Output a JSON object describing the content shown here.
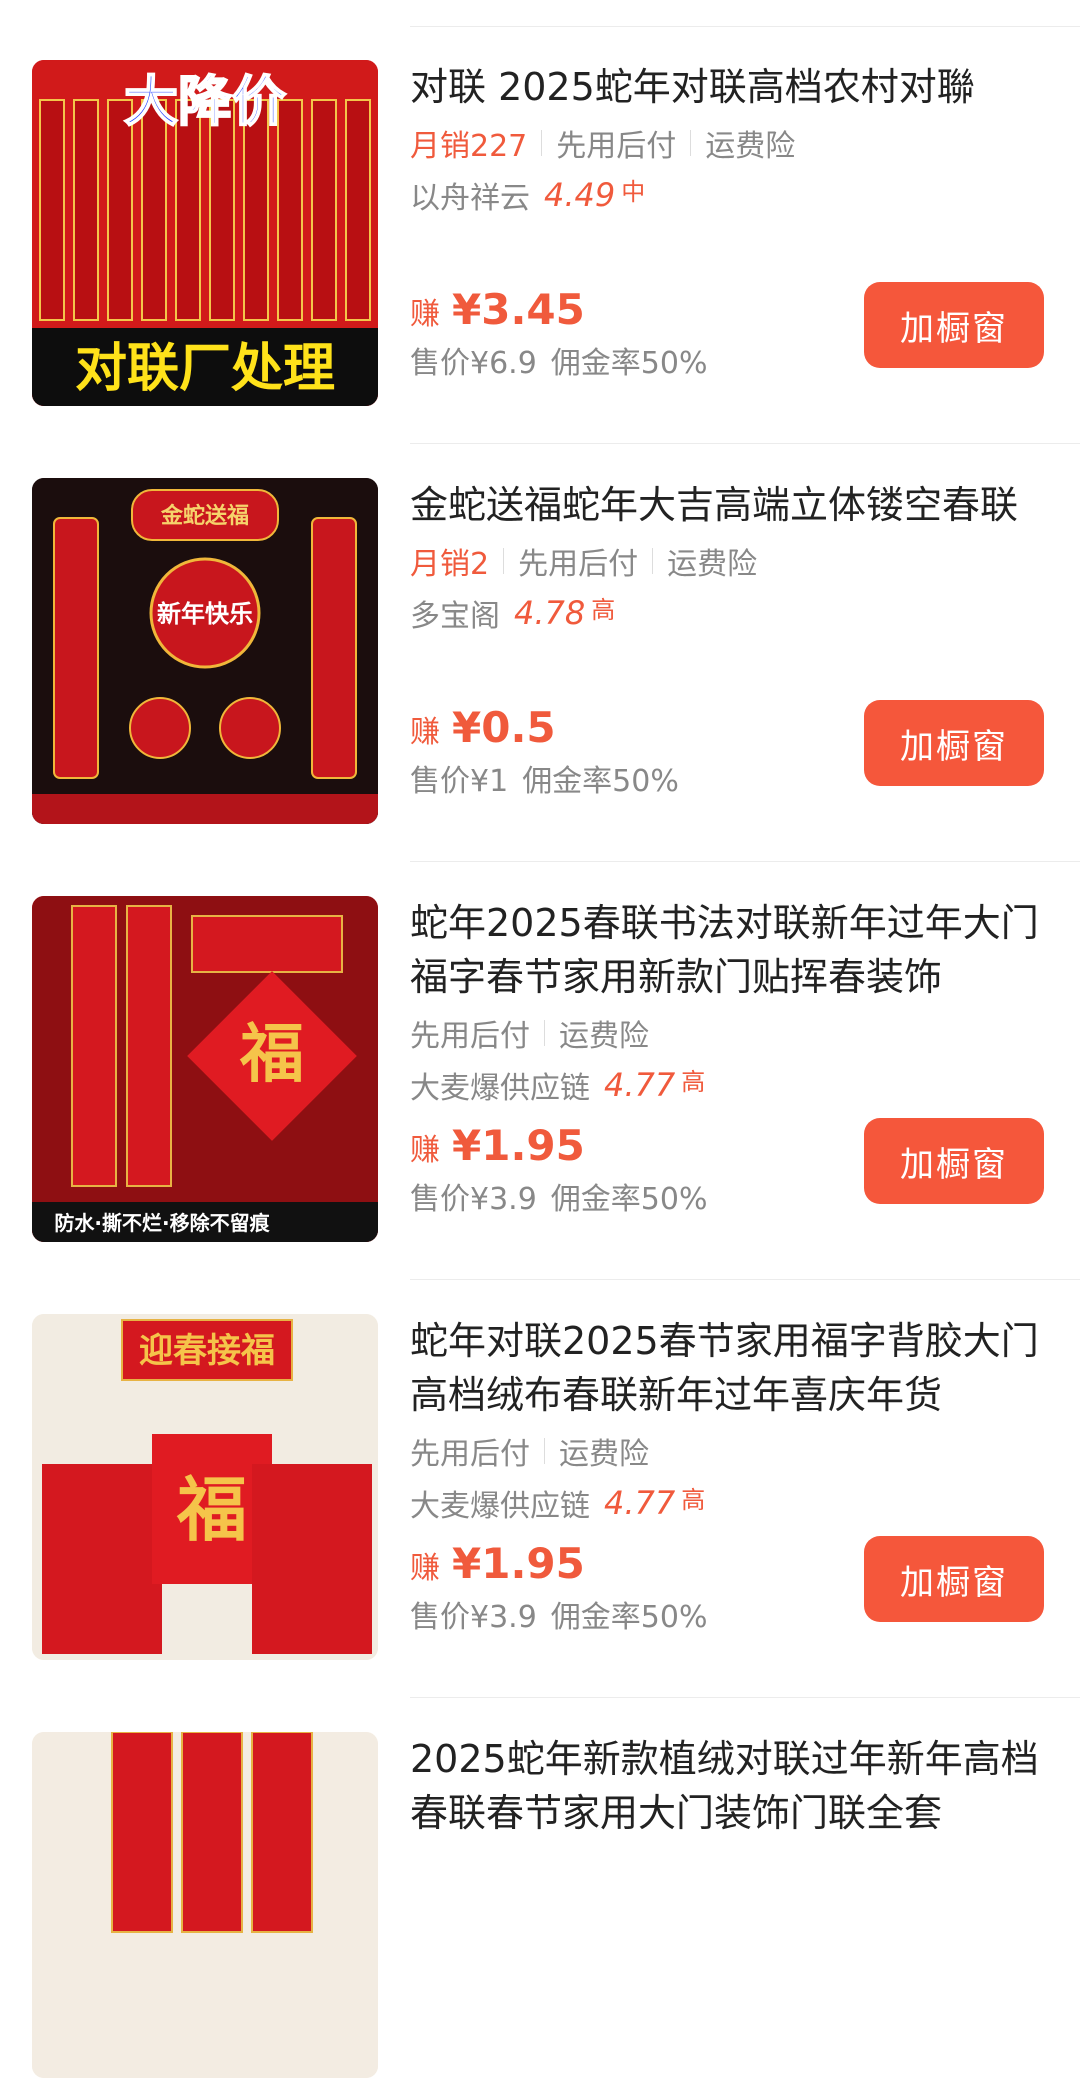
{
  "products": [
    {
      "title": "对联 2025蛇年对联高档农村对聯",
      "tags": [
        "月销227",
        "先用后付",
        "运费险"
      ],
      "shop": "以舟祥云",
      "score": "4.49",
      "grade": "中",
      "earn_label": "赚",
      "earn_amount": "¥3.45",
      "price": "售价¥6.9",
      "commission": "佣金率50%",
      "button": "加橱窗",
      "image_text": [
        "大降价",
        "对联厂处理"
      ]
    },
    {
      "title": "金蛇送福蛇年大吉高端立体镂空春联",
      "tags": [
        "月销2",
        "先用后付",
        "运费险"
      ],
      "shop": "多宝阁",
      "score": "4.78",
      "grade": "高",
      "earn_label": "赚",
      "earn_amount": "¥0.5",
      "price": "售价¥1",
      "commission": "佣金率50%",
      "button": "加橱窗",
      "image_text": [
        "金蛇送福",
        "新年快乐"
      ]
    },
    {
      "title": "蛇年2025春联书法对联新年过年大门福字春节家用新款门贴挥春装饰",
      "tags": [
        "先用后付",
        "运费险"
      ],
      "shop": "大麦爆供应链",
      "score": "4.77",
      "grade": "高",
      "earn_label": "赚",
      "earn_amount": "¥1.95",
      "price": "售价¥3.9",
      "commission": "佣金率50%",
      "button": "加橱窗",
      "image_text": [
        "福",
        "防水·撕不烂·移除不留痕"
      ]
    },
    {
      "title": "蛇年对联2025春节家用福字背胶大门高档绒布春联新年过年喜庆年货",
      "tags": [
        "先用后付",
        "运费险"
      ],
      "shop": "大麦爆供应链",
      "score": "4.77",
      "grade": "高",
      "earn_label": "赚",
      "earn_amount": "¥1.95",
      "price": "售价¥3.9",
      "commission": "佣金率50%",
      "button": "加橱窗",
      "image_text": [
        "迎春接福",
        "福"
      ]
    },
    {
      "title": "2025蛇年新款植绒对联过年新年高档春联春节家用大门装饰门联全套"
    }
  ],
  "colors": {
    "accent": "#f05a3c",
    "button": "#f5573b",
    "image_red": "#c8161d"
  }
}
